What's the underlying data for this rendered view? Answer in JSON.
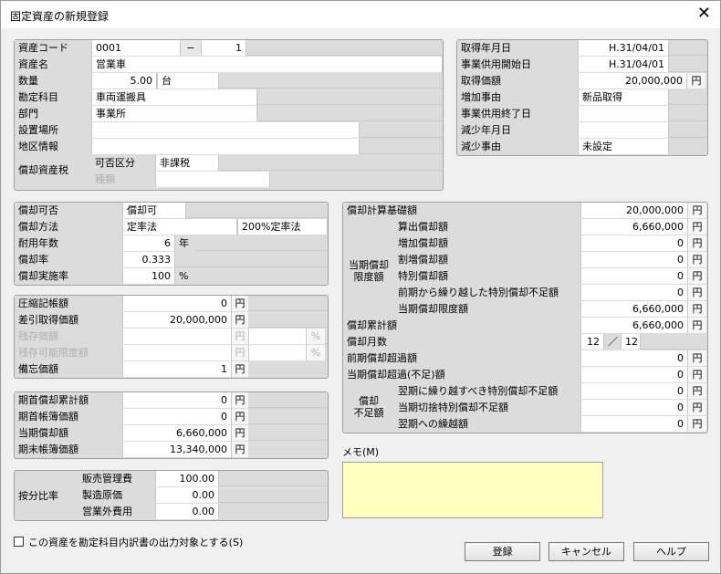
{
  "window": {
    "title": "固定資産の新規登録"
  },
  "asset": {
    "code_label": "資産コード",
    "code": "0001",
    "code_sep": "−",
    "code_branch": "1",
    "name_label": "資産名",
    "name": "営業車",
    "qty_label": "数量",
    "qty": "5.00",
    "qty_unit": "台",
    "account_label": "勘定科目",
    "account": "車両運搬具",
    "dept_label": "部門",
    "dept": "事業所",
    "location_label": "設置場所",
    "location": "",
    "region_label": "地区情報",
    "region": "",
    "tax_label": "償却資産税",
    "tax_class_label": "可否区分",
    "tax_class": "非課税",
    "tax_type_label": "種類",
    "tax_type": ""
  },
  "acquire": {
    "date_label": "取得年月日",
    "date": "H.31/04/01",
    "use_start_label": "事業供用開始日",
    "use_start": "H.31/04/01",
    "price_label": "取得価額",
    "price": "20,000,000",
    "price_unit": "円",
    "increase_label": "増加事由",
    "increase": "新品取得",
    "use_end_label": "事業供用終了日",
    "use_end": "",
    "decrease_date_label": "減少年月日",
    "decrease_date": "",
    "decrease_label": "減少事由",
    "decrease": "未設定"
  },
  "depr": {
    "allowed_label": "償却可否",
    "allowed": "償却可",
    "method_label": "償却方法",
    "method": "定率法",
    "method_sub": "200%定率法",
    "life_label": "耐用年数",
    "life": "6",
    "life_unit": "年",
    "rate_label": "償却率",
    "rate": "0.333",
    "ratio_label": "償却実施率",
    "ratio": "100",
    "ratio_unit": "%"
  },
  "comp": {
    "compressed_label": "圧縮記帳額",
    "compressed": "0",
    "compressed_unit": "円",
    "net_label": "差引取得価額",
    "net": "20,000,000",
    "net_unit": "円",
    "residual_label": "残存価額",
    "residual_unit": "円",
    "residual_pct": "%",
    "residual_limit_label": "残存可能限度額",
    "residual_limit_unit": "円",
    "residual_limit_pct": "%",
    "memo_value_label": "備忘価額",
    "memo_value": "1",
    "memo_value_unit": "円"
  },
  "period": {
    "start_accum_label": "期首償却累計額",
    "start_accum": "0",
    "start_accum_unit": "円",
    "start_book_label": "期首帳簿価額",
    "start_book": "0",
    "start_book_unit": "円",
    "current_label": "当期償却額",
    "current": "6,660,000",
    "current_unit": "円",
    "end_book_label": "期末帳簿価額",
    "end_book": "13,340,000",
    "end_book_unit": "円"
  },
  "alloc": {
    "label": "按分比率",
    "rows": [
      {
        "label": "販売管理費",
        "value": "100.00"
      },
      {
        "label": "製造原価",
        "value": "0.00"
      },
      {
        "label": "営業外費用",
        "value": "0.00"
      }
    ]
  },
  "calc": {
    "base_label": "償却計算基礎額",
    "base": "20,000,000",
    "limit_group_label": "当期償却\n限度額",
    "limit_rows": [
      {
        "label": "算出償却額",
        "value": "6,660,000"
      },
      {
        "label": "増加償却額",
        "value": "0"
      },
      {
        "label": "割増償却額",
        "value": "0"
      },
      {
        "label": "特別償却額",
        "value": "0"
      },
      {
        "label": "前期から繰り越した特別償却不足額",
        "value": "0"
      },
      {
        "label": "当期償却限度額",
        "value": "6,660,000"
      }
    ],
    "accum_label": "償却累計額",
    "accum": "6,660,000",
    "months_label": "償却月数",
    "months": "12",
    "months_sep": "／",
    "months_total": "12",
    "prev_excess_label": "前期償却超過額",
    "prev_excess": "0",
    "cur_excess_label": "当期償却超過(不足)額",
    "cur_excess": "0",
    "short_group_label": "償却\n不足額",
    "short_rows": [
      {
        "label": "翌期に繰り越すべき特別償却不足額",
        "value": "0"
      },
      {
        "label": "当期切捨特別償却不足額",
        "value": "0"
      },
      {
        "label": "翌期への繰越額",
        "value": "0"
      }
    ],
    "yen": "円"
  },
  "memo": {
    "label": "メモ(M)",
    "value": ""
  },
  "footer": {
    "checkbox_label": "この資産を勘定科目内訳書の出力対象とする(S)",
    "register": "登録",
    "cancel": "キャンセル",
    "help": "ヘルプ"
  }
}
